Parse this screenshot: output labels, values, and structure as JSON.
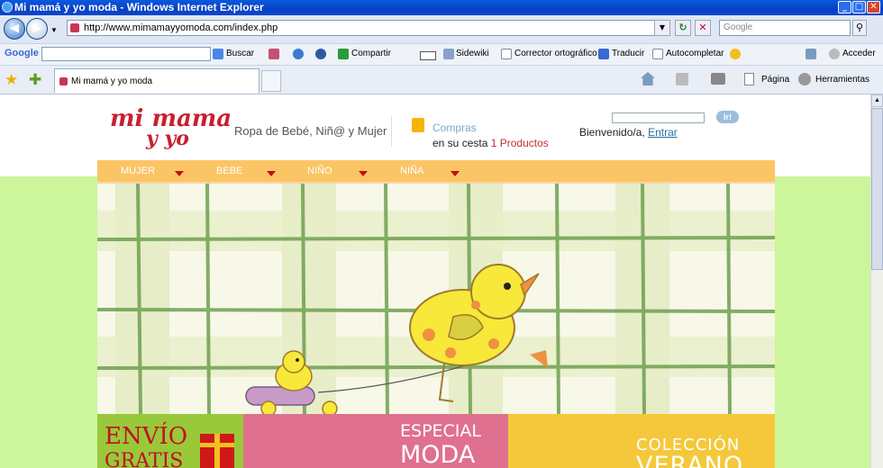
{
  "browser": {
    "window_title": "Mi mamá y yo moda - Windows Internet Explorer",
    "url": "http://www.mimamayyomoda.com/index.php",
    "search_placeholder": "Google",
    "tab_title": "Mi mamá y yo moda",
    "google_label": "Google",
    "toolbar": {
      "buscar": "Buscar",
      "compartir": "Compartir",
      "sidewiki": "Sidewiki",
      "corrector": "Corrector ortográfico",
      "traducir": "Traducir",
      "autocompletar": "Autocompletar",
      "acceder": "Acceder"
    },
    "command_bar": {
      "pagina": "Página",
      "herramientas": "Herramientas"
    }
  },
  "site": {
    "logo_line1": "mi mama",
    "logo_line2": "y yo",
    "tagline": "Ropa de Bebé, Niñ@ y Mujer",
    "cart": {
      "label": "Compras",
      "prefix": "en su cesta",
      "count_text": "1 Productos"
    },
    "login": {
      "go_button": "Ir!",
      "welcome": "Bienvenido/a,",
      "enter_link": "Entrar"
    },
    "nav": [
      "MUJER",
      "BEBE",
      "NIÑO",
      "NIÑA"
    ],
    "promos": {
      "envio_line1": "ENVÍO",
      "envio_line2": "GRATIS",
      "especial_line1": "ESPECIAL",
      "especial_line2": "MODA",
      "coleccion_line1": "COLECCIÓN",
      "coleccion_line2": "VERANO"
    }
  },
  "colors": {
    "nav_bg": "#fbc566",
    "page_green": "#ccf59c",
    "promo_green": "#99c83a",
    "promo_pink": "#e07090",
    "promo_yellow": "#f4c83a",
    "logo_red": "#c82030"
  }
}
